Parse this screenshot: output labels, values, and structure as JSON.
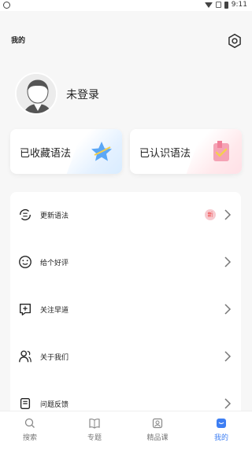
{
  "statusbar": {
    "time": "9:11"
  },
  "page": {
    "title": "我的"
  },
  "profile": {
    "login_text": "未登录"
  },
  "cards": [
    {
      "label": "已收藏语法",
      "icon": "star-icon"
    },
    {
      "label": "已认识语法",
      "icon": "check-bookmark-icon"
    }
  ],
  "menu": {
    "items": [
      {
        "label": "更新语法",
        "icon": "update-icon",
        "badge": "新"
      },
      {
        "label": "给个好评",
        "icon": "smile-icon"
      },
      {
        "label": "关注早道",
        "icon": "add-follow-icon"
      },
      {
        "label": "关于我们",
        "icon": "users-icon"
      },
      {
        "label": "问题反馈",
        "icon": "feedback-icon"
      }
    ]
  },
  "tabbar": {
    "tabs": [
      {
        "label": "搜索",
        "icon": "search-icon",
        "active": false
      },
      {
        "label": "专题",
        "icon": "book-icon",
        "active": false
      },
      {
        "label": "精品课",
        "icon": "course-icon",
        "active": false
      },
      {
        "label": "我的",
        "icon": "profile-icon",
        "active": true
      }
    ]
  },
  "colors": {
    "accent": "#3d7ef3",
    "badge_bg": "#f7c9cf",
    "badge_text": "#ee4444"
  }
}
